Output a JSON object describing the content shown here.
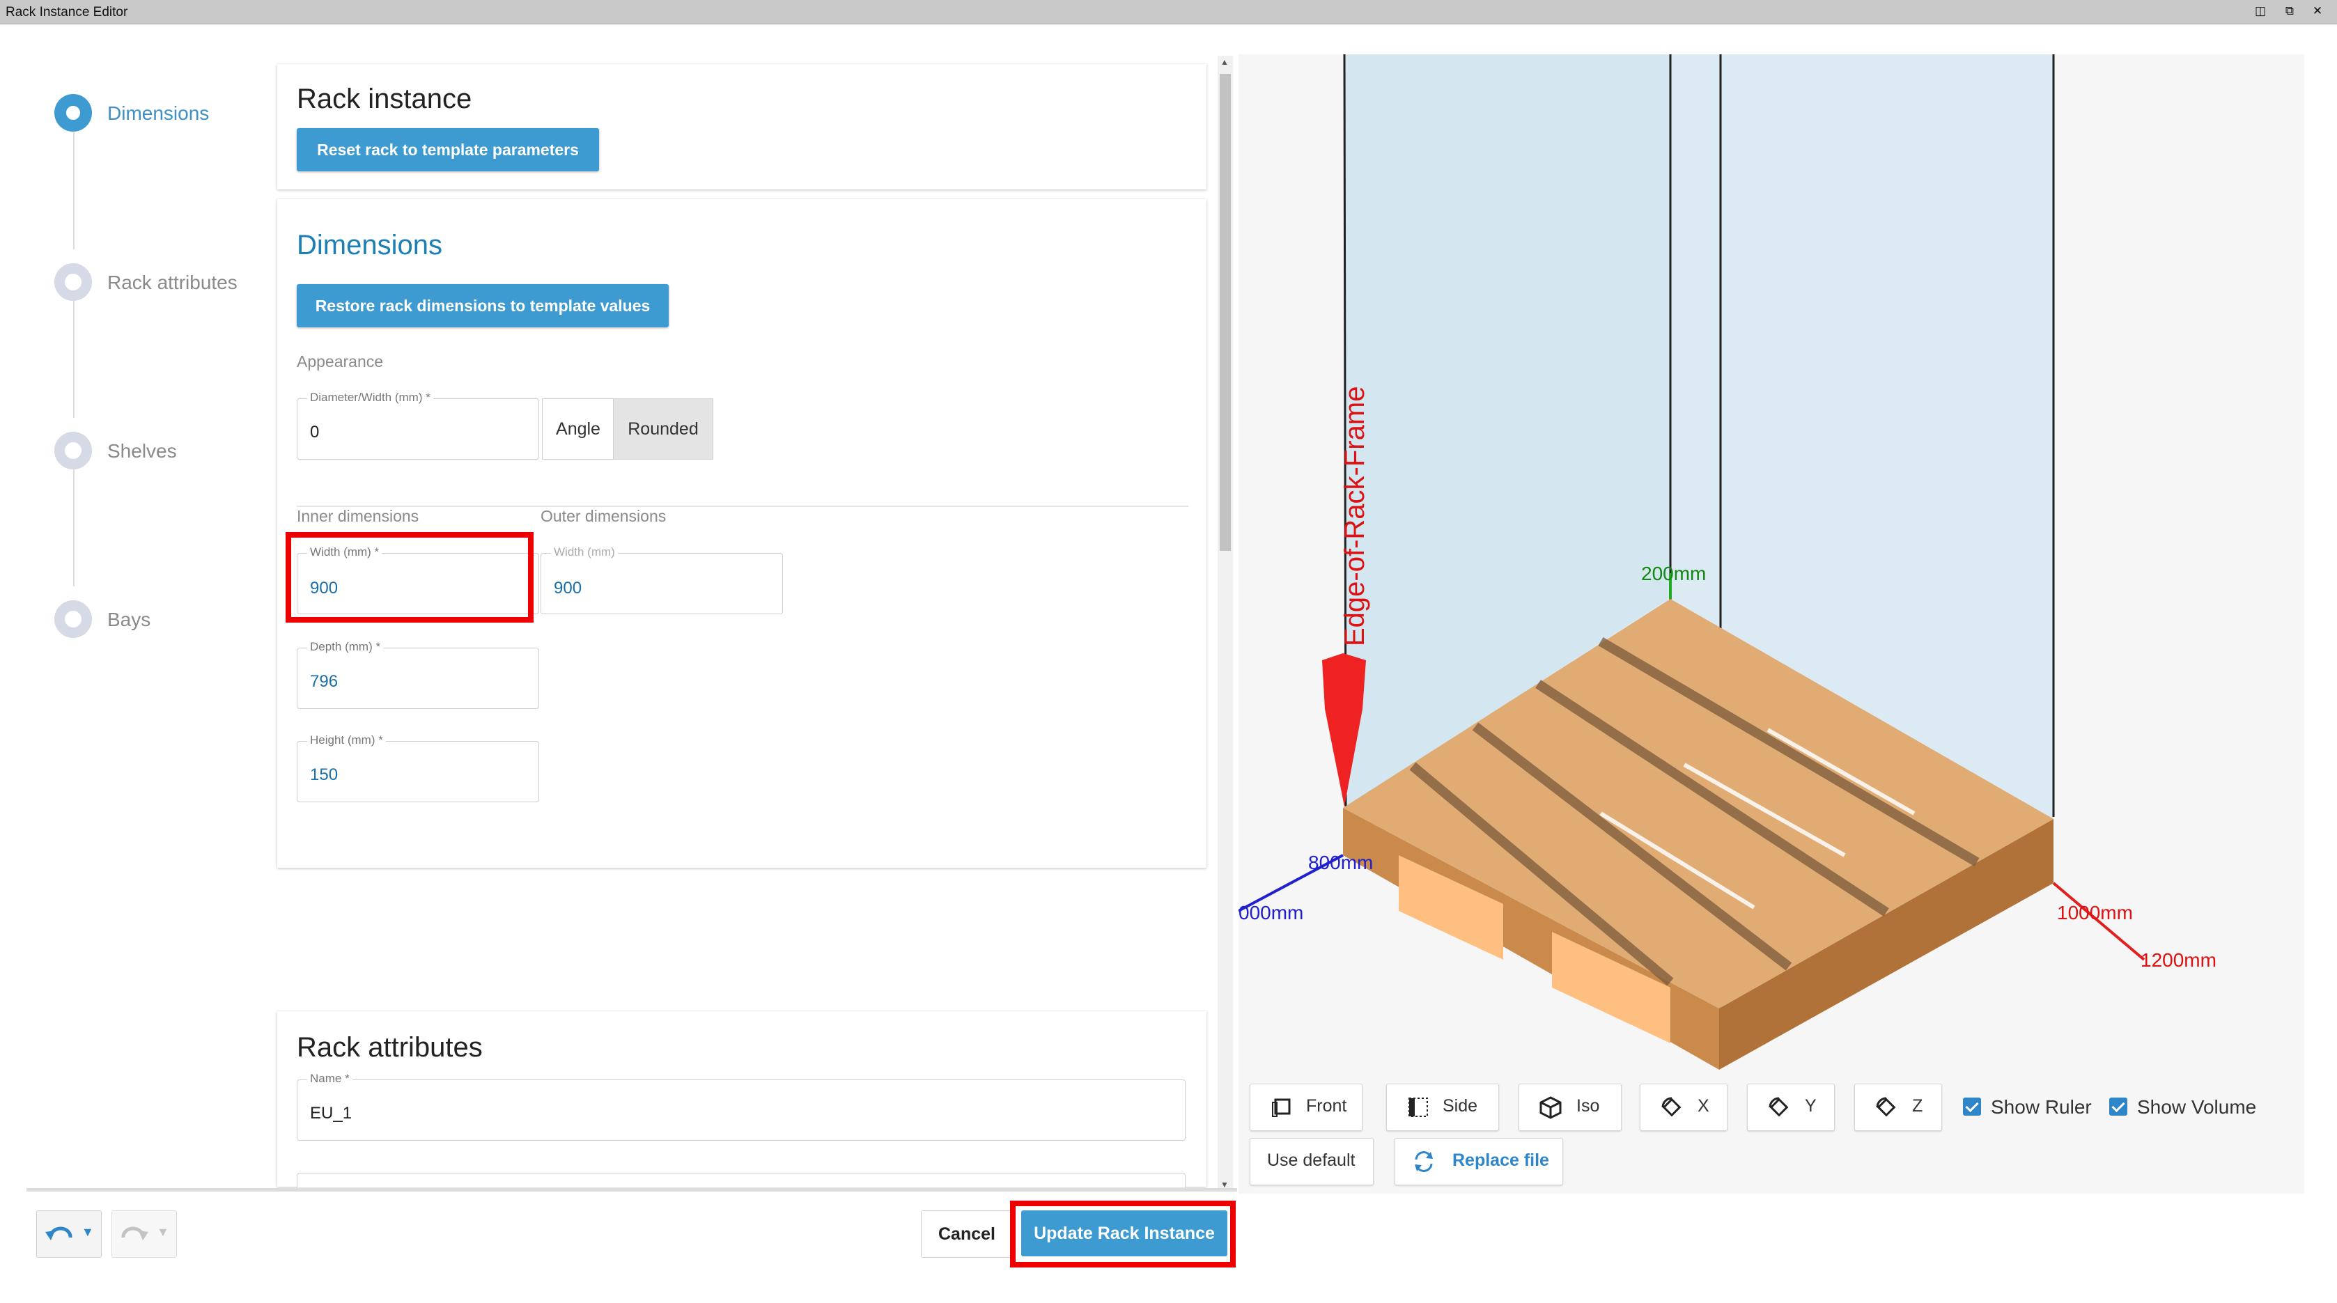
{
  "window": {
    "title": "Rack Instance Editor"
  },
  "steps": [
    {
      "label": "Dimensions",
      "active": true
    },
    {
      "label": "Rack attributes",
      "active": false
    },
    {
      "label": "Shelves",
      "active": false
    },
    {
      "label": "Bays",
      "active": false
    }
  ],
  "rack_instance": {
    "title": "Rack instance",
    "reset_button": "Reset rack to template parameters"
  },
  "dimensions": {
    "title": "Dimensions",
    "restore_button": "Restore rack dimensions to template values",
    "appearance_label": "Appearance",
    "diameter": {
      "label": "Diameter/Width (mm) *",
      "value": "0"
    },
    "appearance_options": [
      "Angle",
      "Rounded"
    ],
    "appearance_selected": "Rounded",
    "inner_label": "Inner dimensions",
    "outer_label": "Outer dimensions",
    "inner_width": {
      "label": "Width (mm) *",
      "value": "900"
    },
    "outer_width": {
      "label": "Width (mm)",
      "value": "900"
    },
    "depth": {
      "label": "Depth (mm) *",
      "value": "796"
    },
    "height": {
      "label": "Height (mm) *",
      "value": "150"
    }
  },
  "rack_attributes": {
    "title": "Rack attributes",
    "name": {
      "label": "Name *",
      "value": "EU_1"
    }
  },
  "viewer": {
    "edge_label": "Edge-of-Rack-Frame",
    "ruler_labels": {
      "top": "200mm",
      "left_depth": "800mm",
      "left_depth2": "000mm",
      "right_width": "1000mm",
      "right_width2": "1200mm"
    },
    "colors": {
      "pallet": "#dba46b",
      "volume": "#dcebf3",
      "ruler_red": "#e02020",
      "ruler_blue": "#2020d0",
      "ruler_green": "#22aa22"
    },
    "toolbar": {
      "front": "Front",
      "side": "Side",
      "iso": "Iso",
      "x": "X",
      "y": "Y",
      "z": "Z",
      "show_ruler": "Show Ruler",
      "show_volume": "Show Volume",
      "show_ruler_checked": true,
      "show_volume_checked": true,
      "use_default": "Use default",
      "replace_file": "Replace file"
    }
  },
  "footer": {
    "cancel": "Cancel",
    "update": "Update Rack Instance"
  }
}
